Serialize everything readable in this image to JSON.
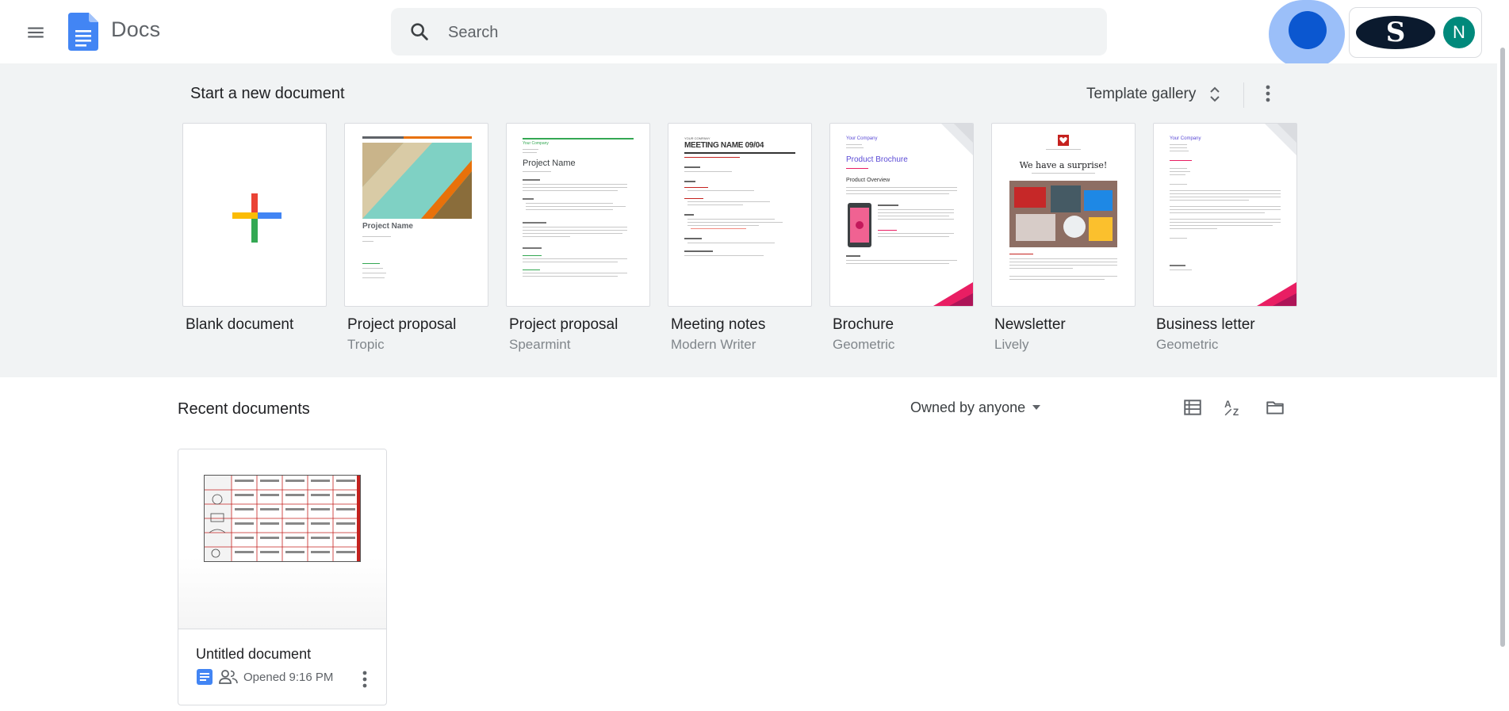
{
  "header": {
    "app_name": "Docs",
    "search_placeholder": "Search",
    "avatar_initial": "N",
    "org_logo_letter": "S"
  },
  "templates": {
    "section_title": "Start a new document",
    "gallery_label": "Template gallery",
    "items": [
      {
        "name": "Blank document",
        "subtitle": ""
      },
      {
        "name": "Project proposal",
        "subtitle": "Tropic",
        "thumb_title": "Project Name"
      },
      {
        "name": "Project proposal",
        "subtitle": "Spearmint",
        "thumb_title": "Project Name",
        "thumb_company": "Your Company"
      },
      {
        "name": "Meeting notes",
        "subtitle": "Modern Writer",
        "thumb_title": "MEETING NAME 09/04",
        "thumb_company": "YOUR COMPANY"
      },
      {
        "name": "Brochure",
        "subtitle": "Geometric",
        "thumb_title": "Product Brochure",
        "thumb_company": "Your Company",
        "thumb_heading": "Product Overview"
      },
      {
        "name": "Newsletter",
        "subtitle": "Lively",
        "thumb_title": "We have a surprise!"
      },
      {
        "name": "Business letter",
        "subtitle": "Geometric",
        "thumb_company": "Your Company"
      }
    ]
  },
  "recent": {
    "section_title": "Recent documents",
    "owner_filter": "Owned by anyone",
    "documents": [
      {
        "name": "Untitled document",
        "opened": "Opened 9:16 PM"
      }
    ]
  },
  "colors": {
    "accent_blue": "#0b57d0",
    "docs_blue": "#4285f4",
    "panel_bg": "#f1f3f4"
  }
}
